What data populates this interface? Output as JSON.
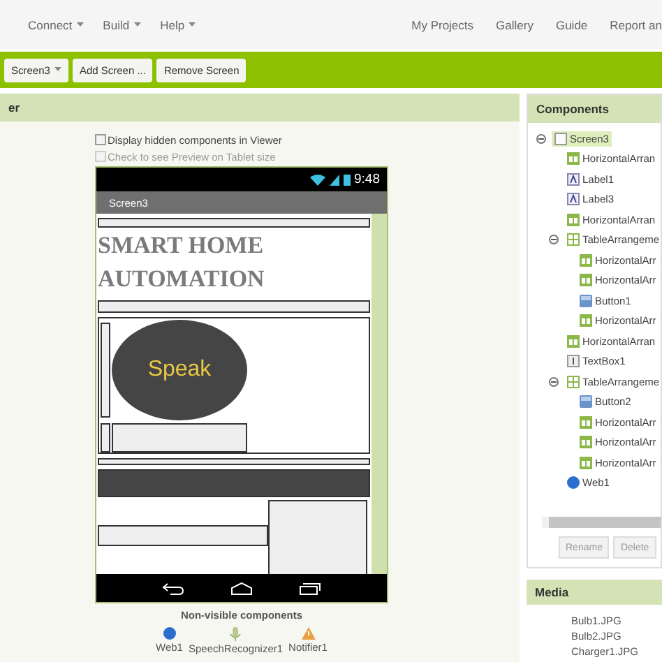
{
  "top_menu": {
    "left": [
      "Connect",
      "Build",
      "Help"
    ],
    "right": [
      "My Projects",
      "Gallery",
      "Guide",
      "Report an"
    ]
  },
  "toolbar": {
    "screen_select": "Screen3",
    "buttons": [
      "Add Screen ...",
      "Remove Screen"
    ]
  },
  "viewer": {
    "title": "er",
    "options": [
      {
        "label": "Display hidden components in Viewer",
        "checked": false,
        "disabled": false
      },
      {
        "label": "Check to see Preview on Tablet size",
        "checked": false,
        "disabled": true
      }
    ],
    "phone": {
      "time": "9:48",
      "screen_title": "Screen3",
      "label": "SMART HOME AUTOMATION",
      "button": "Speak"
    },
    "nonvisible": {
      "title": "Non-visible components",
      "items": [
        {
          "kind": "web",
          "label": "Web1"
        },
        {
          "kind": "speech",
          "label": "SpeechRecognizer1"
        },
        {
          "kind": "notifier",
          "label": "Notifier1"
        }
      ]
    }
  },
  "components": {
    "title": "Components",
    "tree": [
      {
        "kind": "screen",
        "label": "Screen3",
        "selected": true,
        "expanded": true,
        "children": [
          {
            "kind": "arrangement",
            "label": "HorizontalArran",
            "selected": false
          },
          {
            "kind": "label",
            "label": "Label1",
            "selected": false
          },
          {
            "kind": "label",
            "label": "Label3",
            "selected": false
          },
          {
            "kind": "arrangement",
            "label": "HorizontalArran",
            "selected": false
          },
          {
            "kind": "table",
            "label": "TableArrangeme",
            "selected": false,
            "expanded": true,
            "children": [
              {
                "kind": "arrangement",
                "label": "HorizontalArr",
                "selected": false
              },
              {
                "kind": "arrangement",
                "label": "HorizontalArr",
                "selected": false
              },
              {
                "kind": "button",
                "label": "Button1",
                "selected": false
              },
              {
                "kind": "arrangement",
                "label": "HorizontalArr",
                "selected": false
              }
            ]
          },
          {
            "kind": "arrangement",
            "label": "HorizontalArran",
            "selected": false
          },
          {
            "kind": "textbox",
            "label": "TextBox1",
            "selected": false
          },
          {
            "kind": "table",
            "label": "TableArrangeme",
            "selected": false,
            "expanded": true,
            "children": [
              {
                "kind": "button",
                "label": "Button2",
                "selected": false
              },
              {
                "kind": "arrangement",
                "label": "HorizontalArr",
                "selected": false
              },
              {
                "kind": "arrangement",
                "label": "HorizontalArr",
                "selected": false
              },
              {
                "kind": "arrangement",
                "label": "HorizontalArr",
                "selected": false
              }
            ]
          },
          {
            "kind": "web",
            "label": "Web1",
            "selected": false
          }
        ]
      }
    ],
    "buttons": [
      "Rename",
      "Delete"
    ]
  },
  "media": {
    "title": "Media",
    "files": [
      "Bulb1.JPG",
      "Bulb2.JPG",
      "Charger1.JPG"
    ]
  }
}
